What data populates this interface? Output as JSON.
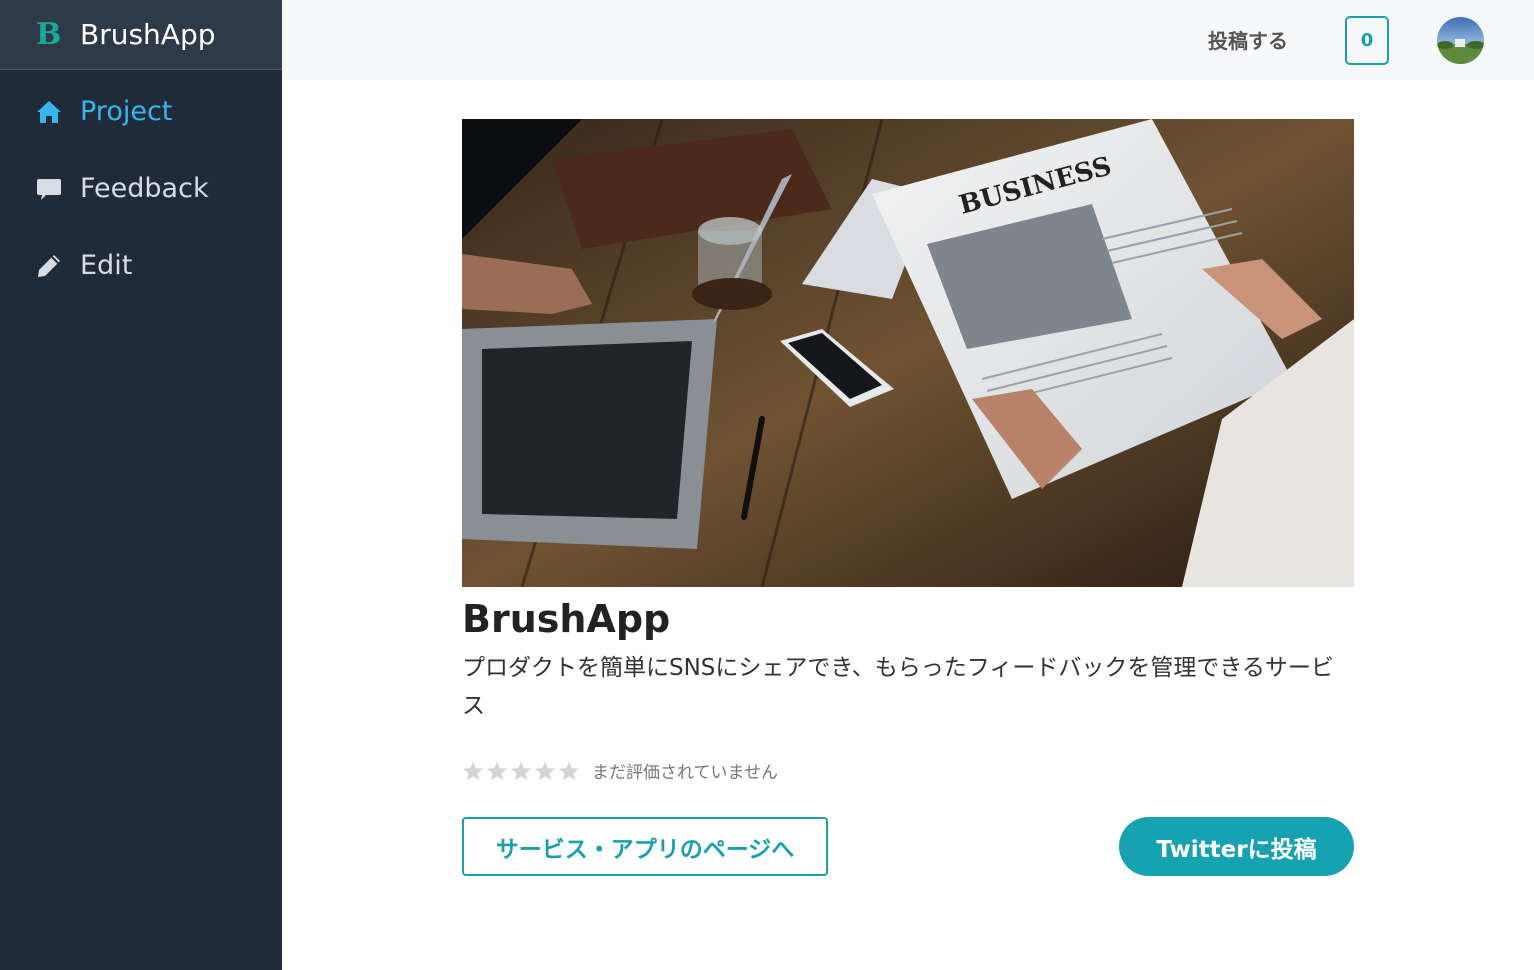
{
  "sidebar": {
    "brand_logo": "B",
    "brand_name": "BrushApp",
    "items": [
      {
        "label": "Project",
        "icon": "home-icon",
        "active": true
      },
      {
        "label": "Feedback",
        "icon": "comment-icon",
        "active": false
      },
      {
        "label": "Edit",
        "icon": "pencil-icon",
        "active": false
      }
    ]
  },
  "header": {
    "post_label": "投稿する",
    "notification_count": "0"
  },
  "project": {
    "image_alt": "newspaper-laptop-photo",
    "title": "BrushApp",
    "description": "プロダクトを簡単にSNSにシェアでき、もらったフィードバックを管理できるサービス",
    "rating": {
      "stars": 0,
      "max": 5,
      "text": "まだ評価されていません"
    },
    "visit_button": "サービス・アプリのページへ",
    "twitter_button": "Twitterに投稿"
  },
  "colors": {
    "sidebar_bg": "#1f2b39",
    "brand_bg": "#2e3a48",
    "active": "#3ab4ec",
    "accent": "#1aa0ad",
    "twitter_bg": "#17a2b2"
  }
}
